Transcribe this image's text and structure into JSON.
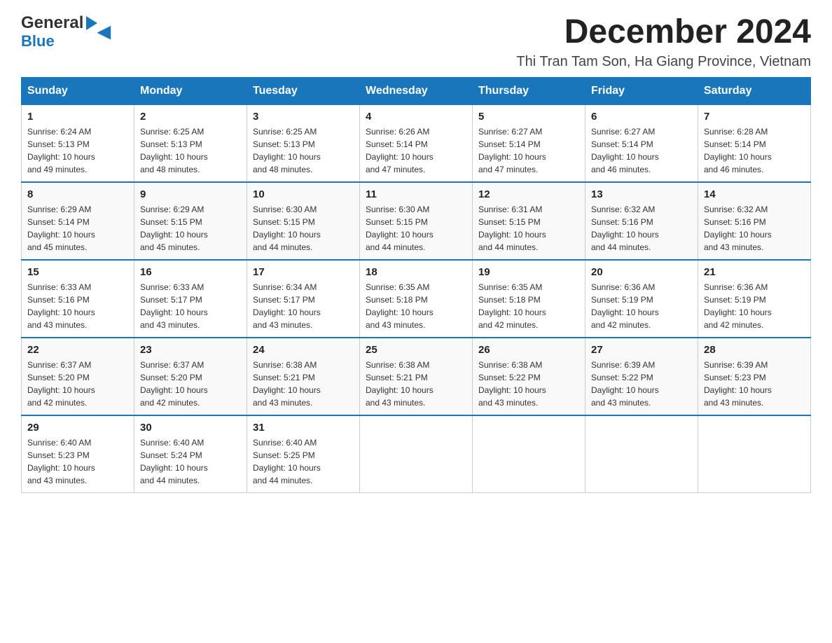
{
  "logo": {
    "general": "General",
    "blue": "Blue",
    "triangle": "▼"
  },
  "title": "December 2024",
  "location": "Thi Tran Tam Son, Ha Giang Province, Vietnam",
  "days_of_week": [
    "Sunday",
    "Monday",
    "Tuesday",
    "Wednesday",
    "Thursday",
    "Friday",
    "Saturday"
  ],
  "weeks": [
    [
      {
        "day": "1",
        "sunrise": "6:24 AM",
        "sunset": "5:13 PM",
        "daylight": "10 hours and 49 minutes."
      },
      {
        "day": "2",
        "sunrise": "6:25 AM",
        "sunset": "5:13 PM",
        "daylight": "10 hours and 48 minutes."
      },
      {
        "day": "3",
        "sunrise": "6:25 AM",
        "sunset": "5:13 PM",
        "daylight": "10 hours and 48 minutes."
      },
      {
        "day": "4",
        "sunrise": "6:26 AM",
        "sunset": "5:14 PM",
        "daylight": "10 hours and 47 minutes."
      },
      {
        "day": "5",
        "sunrise": "6:27 AM",
        "sunset": "5:14 PM",
        "daylight": "10 hours and 47 minutes."
      },
      {
        "day": "6",
        "sunrise": "6:27 AM",
        "sunset": "5:14 PM",
        "daylight": "10 hours and 46 minutes."
      },
      {
        "day": "7",
        "sunrise": "6:28 AM",
        "sunset": "5:14 PM",
        "daylight": "10 hours and 46 minutes."
      }
    ],
    [
      {
        "day": "8",
        "sunrise": "6:29 AM",
        "sunset": "5:14 PM",
        "daylight": "10 hours and 45 minutes."
      },
      {
        "day": "9",
        "sunrise": "6:29 AM",
        "sunset": "5:15 PM",
        "daylight": "10 hours and 45 minutes."
      },
      {
        "day": "10",
        "sunrise": "6:30 AM",
        "sunset": "5:15 PM",
        "daylight": "10 hours and 44 minutes."
      },
      {
        "day": "11",
        "sunrise": "6:30 AM",
        "sunset": "5:15 PM",
        "daylight": "10 hours and 44 minutes."
      },
      {
        "day": "12",
        "sunrise": "6:31 AM",
        "sunset": "5:15 PM",
        "daylight": "10 hours and 44 minutes."
      },
      {
        "day": "13",
        "sunrise": "6:32 AM",
        "sunset": "5:16 PM",
        "daylight": "10 hours and 44 minutes."
      },
      {
        "day": "14",
        "sunrise": "6:32 AM",
        "sunset": "5:16 PM",
        "daylight": "10 hours and 43 minutes."
      }
    ],
    [
      {
        "day": "15",
        "sunrise": "6:33 AM",
        "sunset": "5:16 PM",
        "daylight": "10 hours and 43 minutes."
      },
      {
        "day": "16",
        "sunrise": "6:33 AM",
        "sunset": "5:17 PM",
        "daylight": "10 hours and 43 minutes."
      },
      {
        "day": "17",
        "sunrise": "6:34 AM",
        "sunset": "5:17 PM",
        "daylight": "10 hours and 43 minutes."
      },
      {
        "day": "18",
        "sunrise": "6:35 AM",
        "sunset": "5:18 PM",
        "daylight": "10 hours and 43 minutes."
      },
      {
        "day": "19",
        "sunrise": "6:35 AM",
        "sunset": "5:18 PM",
        "daylight": "10 hours and 42 minutes."
      },
      {
        "day": "20",
        "sunrise": "6:36 AM",
        "sunset": "5:19 PM",
        "daylight": "10 hours and 42 minutes."
      },
      {
        "day": "21",
        "sunrise": "6:36 AM",
        "sunset": "5:19 PM",
        "daylight": "10 hours and 42 minutes."
      }
    ],
    [
      {
        "day": "22",
        "sunrise": "6:37 AM",
        "sunset": "5:20 PM",
        "daylight": "10 hours and 42 minutes."
      },
      {
        "day": "23",
        "sunrise": "6:37 AM",
        "sunset": "5:20 PM",
        "daylight": "10 hours and 42 minutes."
      },
      {
        "day": "24",
        "sunrise": "6:38 AM",
        "sunset": "5:21 PM",
        "daylight": "10 hours and 43 minutes."
      },
      {
        "day": "25",
        "sunrise": "6:38 AM",
        "sunset": "5:21 PM",
        "daylight": "10 hours and 43 minutes."
      },
      {
        "day": "26",
        "sunrise": "6:38 AM",
        "sunset": "5:22 PM",
        "daylight": "10 hours and 43 minutes."
      },
      {
        "day": "27",
        "sunrise": "6:39 AM",
        "sunset": "5:22 PM",
        "daylight": "10 hours and 43 minutes."
      },
      {
        "day": "28",
        "sunrise": "6:39 AM",
        "sunset": "5:23 PM",
        "daylight": "10 hours and 43 minutes."
      }
    ],
    [
      {
        "day": "29",
        "sunrise": "6:40 AM",
        "sunset": "5:23 PM",
        "daylight": "10 hours and 43 minutes."
      },
      {
        "day": "30",
        "sunrise": "6:40 AM",
        "sunset": "5:24 PM",
        "daylight": "10 hours and 44 minutes."
      },
      {
        "day": "31",
        "sunrise": "6:40 AM",
        "sunset": "5:25 PM",
        "daylight": "10 hours and 44 minutes."
      },
      null,
      null,
      null,
      null
    ]
  ],
  "labels": {
    "sunrise": "Sunrise:",
    "sunset": "Sunset:",
    "daylight": "Daylight:"
  }
}
